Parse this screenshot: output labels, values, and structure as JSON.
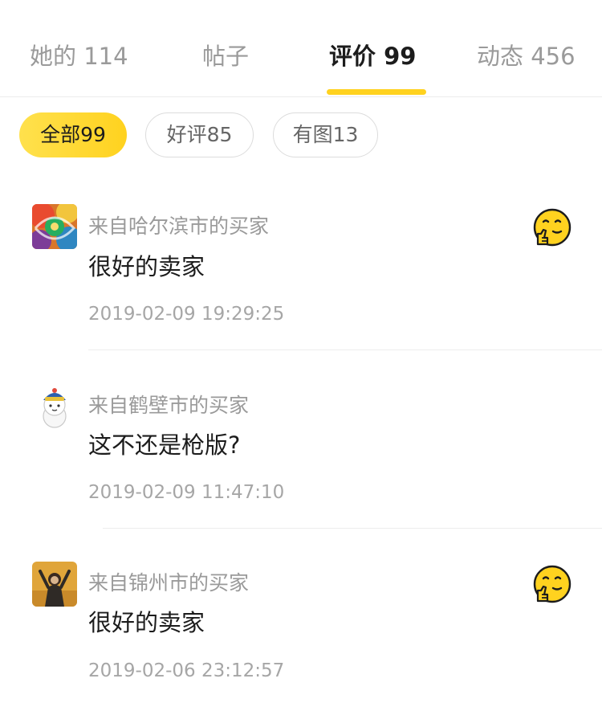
{
  "tabs": [
    {
      "label": "她的 114",
      "active": false
    },
    {
      "label": "帖子",
      "active": false
    },
    {
      "label": "评价 99",
      "active": true
    },
    {
      "label": "动态 456",
      "active": false
    }
  ],
  "filters": [
    {
      "label": "全部99",
      "active": true
    },
    {
      "label": "好评85",
      "active": false
    },
    {
      "label": "有图13",
      "active": false
    }
  ],
  "reviews": [
    {
      "buyer": "来自哈尔滨市的买家",
      "content": "很好的卖家",
      "time": "2019-02-09 19:29:25",
      "rating_icon": "thinking-face-icon"
    },
    {
      "buyer": "来自鹤壁市的买家",
      "content": "这不还是枪版?",
      "time": "2019-02-09 11:47:10",
      "rating_icon": null
    },
    {
      "buyer": "来自锦州市的买家",
      "content": "很好的卖家",
      "time": "2019-02-06 23:12:57",
      "rating_icon": "thinking-face-icon"
    }
  ],
  "colors": {
    "accent": "#ffd21f",
    "text_primary": "#1c1c1c",
    "text_secondary": "#9a9a9a"
  }
}
